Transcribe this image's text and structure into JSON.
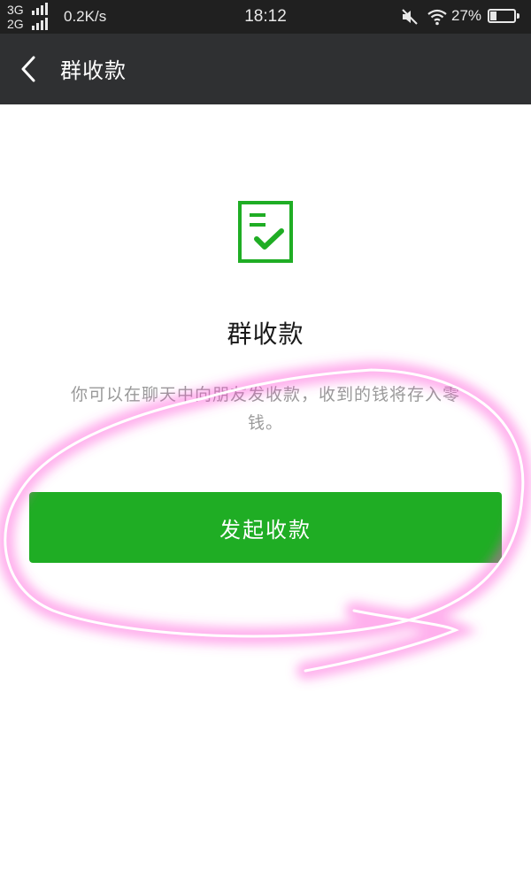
{
  "status_bar": {
    "network_top": "3G",
    "network_bottom": "2G",
    "net_speed": "0.2K/s",
    "time": "18:12",
    "battery_percent": "27%",
    "battery_level": 0.27
  },
  "nav": {
    "title": "群收款",
    "back_icon": "chevron-left-icon"
  },
  "content": {
    "icon": "receipt-check-icon",
    "heading": "群收款",
    "description": "你可以在聊天中向朋友发收款，收到的钱将存入零钱。",
    "start_button_label": "发起收款"
  },
  "colors": {
    "accent": "#1fad24",
    "nav_background": "#2f3032",
    "status_background": "#202020",
    "highlight": "#ff4fd8"
  }
}
